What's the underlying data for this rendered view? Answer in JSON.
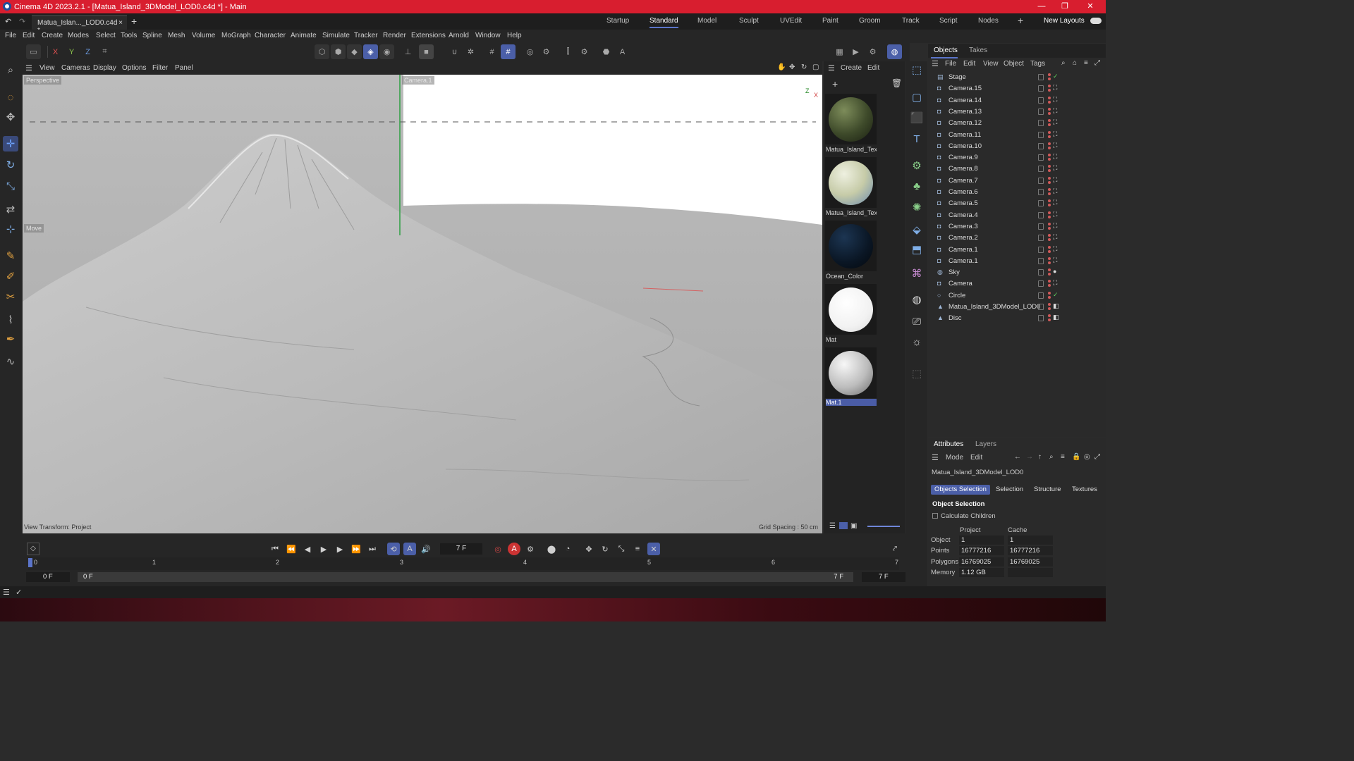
{
  "window": {
    "title": "Cinema 4D 2023.2.1 - [Matua_Island_3DModel_LOD0.c4d *] - Main"
  },
  "tab": {
    "doc": "Matua_Islan..._LOD0.c4d *"
  },
  "layouts": [
    "Startup",
    "Standard",
    "Model",
    "Sculpt",
    "UVEdit",
    "Paint",
    "Groom",
    "Track",
    "Script",
    "Nodes"
  ],
  "layouts_new": "New Layouts",
  "menu": [
    "File",
    "Edit",
    "Create",
    "Modes",
    "Select",
    "Tools",
    "Spline",
    "Mesh",
    "Volume",
    "MoGraph",
    "Character",
    "Animate",
    "Simulate",
    "Tracker",
    "Render",
    "Extensions",
    "Arnold",
    "Window",
    "Help"
  ],
  "axis": {
    "x": "X",
    "y": "Y",
    "z": "Z"
  },
  "viewport_menu": [
    "View",
    "Cameras",
    "Display",
    "Options",
    "Filter",
    "Panel"
  ],
  "viewport": {
    "label_tl": "Perspective",
    "label_top": "Camera.1",
    "move_label": "Move",
    "view_transform": "View Transform: Project",
    "grid_spacing": "Grid Spacing : 50 cm",
    "axis_z": "Z",
    "axis_x": "X"
  },
  "material_menu": [
    "Create",
    "Edit"
  ],
  "materials": [
    {
      "name": "Matua_Island_Text",
      "color": "#4a5a35"
    },
    {
      "name": "Matua_Island_Text",
      "color": "#c9cfb6"
    },
    {
      "name": "Ocean_Color",
      "color": "#0c1a2c"
    },
    {
      "name": "Mat",
      "color": "#ffffff"
    },
    {
      "name": "Mat.1",
      "color": "#cfcfcf"
    }
  ],
  "objects_tabs": [
    "Objects",
    "Takes"
  ],
  "objects_menu": [
    "File",
    "Edit",
    "View",
    "Object",
    "Tags"
  ],
  "objects": [
    {
      "name": "Stage",
      "icon": "stage-icon"
    },
    {
      "name": "Camera.15",
      "icon": "camera-icon"
    },
    {
      "name": "Camera.14",
      "icon": "camera-icon"
    },
    {
      "name": "Camera.13",
      "icon": "camera-icon"
    },
    {
      "name": "Camera.12",
      "icon": "camera-icon"
    },
    {
      "name": "Camera.11",
      "icon": "camera-icon"
    },
    {
      "name": "Camera.10",
      "icon": "camera-icon"
    },
    {
      "name": "Camera.9",
      "icon": "camera-icon"
    },
    {
      "name": "Camera.8",
      "icon": "camera-icon"
    },
    {
      "name": "Camera.7",
      "icon": "camera-icon"
    },
    {
      "name": "Camera.6",
      "icon": "camera-icon"
    },
    {
      "name": "Camera.5",
      "icon": "camera-icon"
    },
    {
      "name": "Camera.4",
      "icon": "camera-icon"
    },
    {
      "name": "Camera.3",
      "icon": "camera-icon"
    },
    {
      "name": "Camera.2",
      "icon": "camera-icon"
    },
    {
      "name": "Camera.1",
      "icon": "camera-icon"
    },
    {
      "name": "Camera.1",
      "icon": "camera-icon"
    },
    {
      "name": "Sky",
      "icon": "sky-icon"
    },
    {
      "name": "Camera",
      "icon": "camera-icon"
    },
    {
      "name": "Circle",
      "icon": "circle-icon"
    },
    {
      "name": "Matua_Island_3DModel_LOD0",
      "icon": "polygon-icon"
    },
    {
      "name": "Disc",
      "icon": "polygon-icon"
    }
  ],
  "attributes": {
    "tabs": [
      "Attributes",
      "Layers"
    ],
    "menu": [
      "Mode",
      "Edit"
    ],
    "object_name": "Matua_Island_3DModel_LOD0",
    "subtabs": [
      "Objects Selection",
      "Selection",
      "Structure",
      "Textures"
    ],
    "section": "Object Selection",
    "calc_children": "Calculate Children",
    "col_project": "Project",
    "col_cache": "Cache",
    "rows": [
      {
        "label": "Object",
        "project": "1",
        "cache": "1"
      },
      {
        "label": "Points",
        "project": "16777216",
        "cache": "16777216"
      },
      {
        "label": "Polygons",
        "project": "16769025",
        "cache": "16769025"
      },
      {
        "label": "Memory",
        "project": "1.12 GB",
        "cache": ""
      }
    ]
  },
  "timeline": {
    "frame_field": "7 F",
    "ruler": [
      "0",
      "1",
      "2",
      "3",
      "4",
      "5",
      "6",
      "7"
    ],
    "start": "0 F",
    "start2": "0 F",
    "end": "7 F",
    "end2": "7 F"
  }
}
